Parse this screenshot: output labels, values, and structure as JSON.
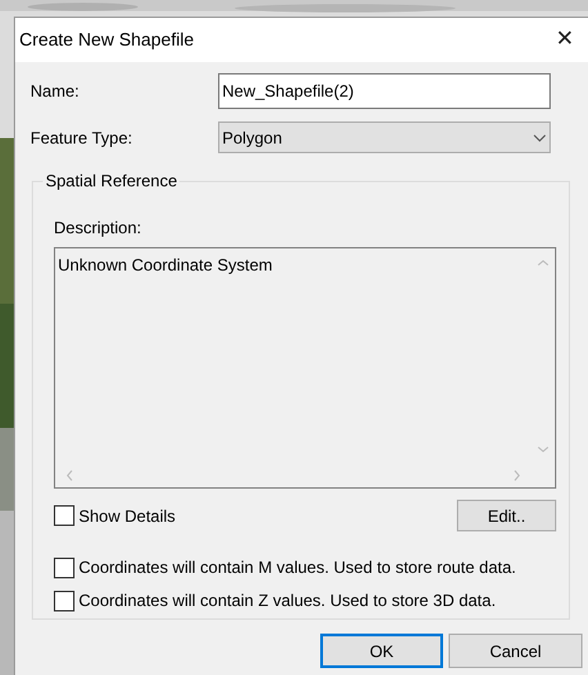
{
  "window": {
    "title": "Create New Shapefile",
    "close": "✕"
  },
  "name": {
    "label": "Name:",
    "value": "New_Shapefile(2)"
  },
  "feature_type": {
    "label": "Feature Type:",
    "value": "Polygon"
  },
  "spatial_reference": {
    "title": "Spatial Reference",
    "description_label": "Description:",
    "description": "Unknown Coordinate System",
    "show_details": {
      "label": "Show Details",
      "checked": false
    },
    "edit_button": "Edit.."
  },
  "options": [
    {
      "label": "Coordinates will contain M values. Used to store route data.",
      "checked": false
    },
    {
      "label": "Coordinates will contain Z values. Used to store 3D data.",
      "checked": false
    }
  ],
  "buttons": [
    {
      "label": "OK",
      "default": true
    },
    {
      "label": "Cancel",
      "default": false
    }
  ]
}
